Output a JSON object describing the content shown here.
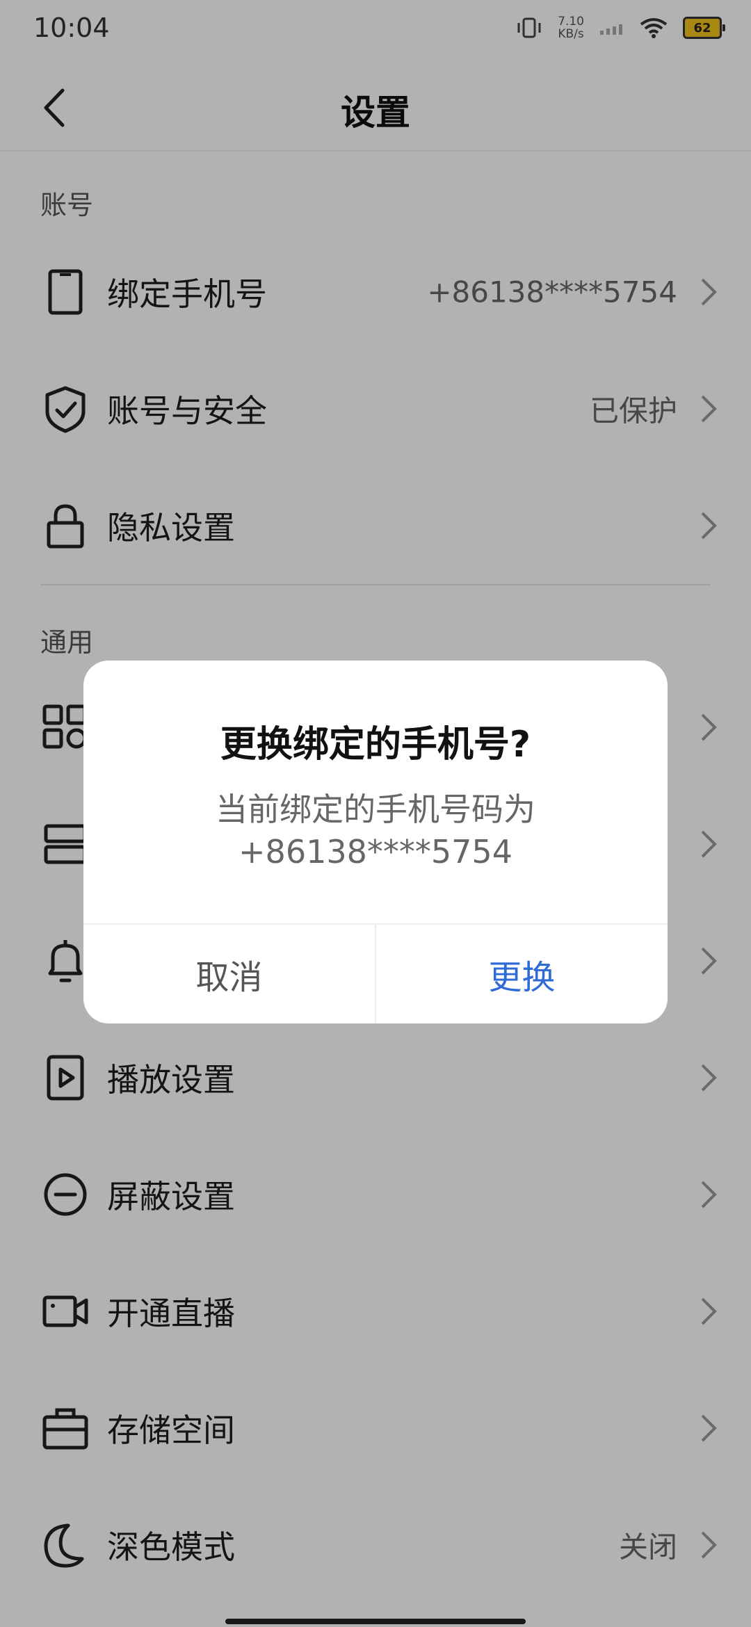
{
  "status_bar": {
    "time": "10:04",
    "net_speed_value": "7.10",
    "net_speed_unit": "KB/s",
    "battery": "62",
    "icons": [
      "vibrate-icon",
      "signal-icon",
      "wifi-icon",
      "battery-icon"
    ]
  },
  "header": {
    "title": "设置"
  },
  "sections": {
    "account": "账号",
    "general": "通用"
  },
  "rows": {
    "bind_phone": {
      "label": "绑定手机号",
      "value": "+86138****5754",
      "icon": "phone-icon"
    },
    "account_security": {
      "label": "账号与安全",
      "value": "已保护",
      "icon": "shield-icon"
    },
    "privacy": {
      "label": "隐私设置",
      "value": "",
      "icon": "lock-icon"
    },
    "general_1": {
      "label": "",
      "icon": "grid-icon"
    },
    "general_2": {
      "label": "",
      "icon": "layout-icon"
    },
    "general_3": {
      "label": "",
      "icon": "bell-icon"
    },
    "playback": {
      "label": "播放设置",
      "icon": "play-icon"
    },
    "block": {
      "label": "屏蔽设置",
      "icon": "block-icon"
    },
    "live": {
      "label": "开通直播",
      "icon": "camera-icon"
    },
    "storage": {
      "label": "存储空间",
      "icon": "briefcase-icon"
    },
    "dark_mode": {
      "label": "深色模式",
      "value": "关闭",
      "icon": "moon-icon"
    }
  },
  "dialog": {
    "title": "更换绑定的手机号?",
    "message_line1": "当前绑定的手机号码为",
    "message_line2": "+86138****5754",
    "cancel": "取消",
    "confirm": "更换"
  },
  "colors": {
    "accent": "#2f6bd7",
    "overlay": "rgba(0,0,0,0.30)",
    "battery_fill": "#f3c21c"
  }
}
